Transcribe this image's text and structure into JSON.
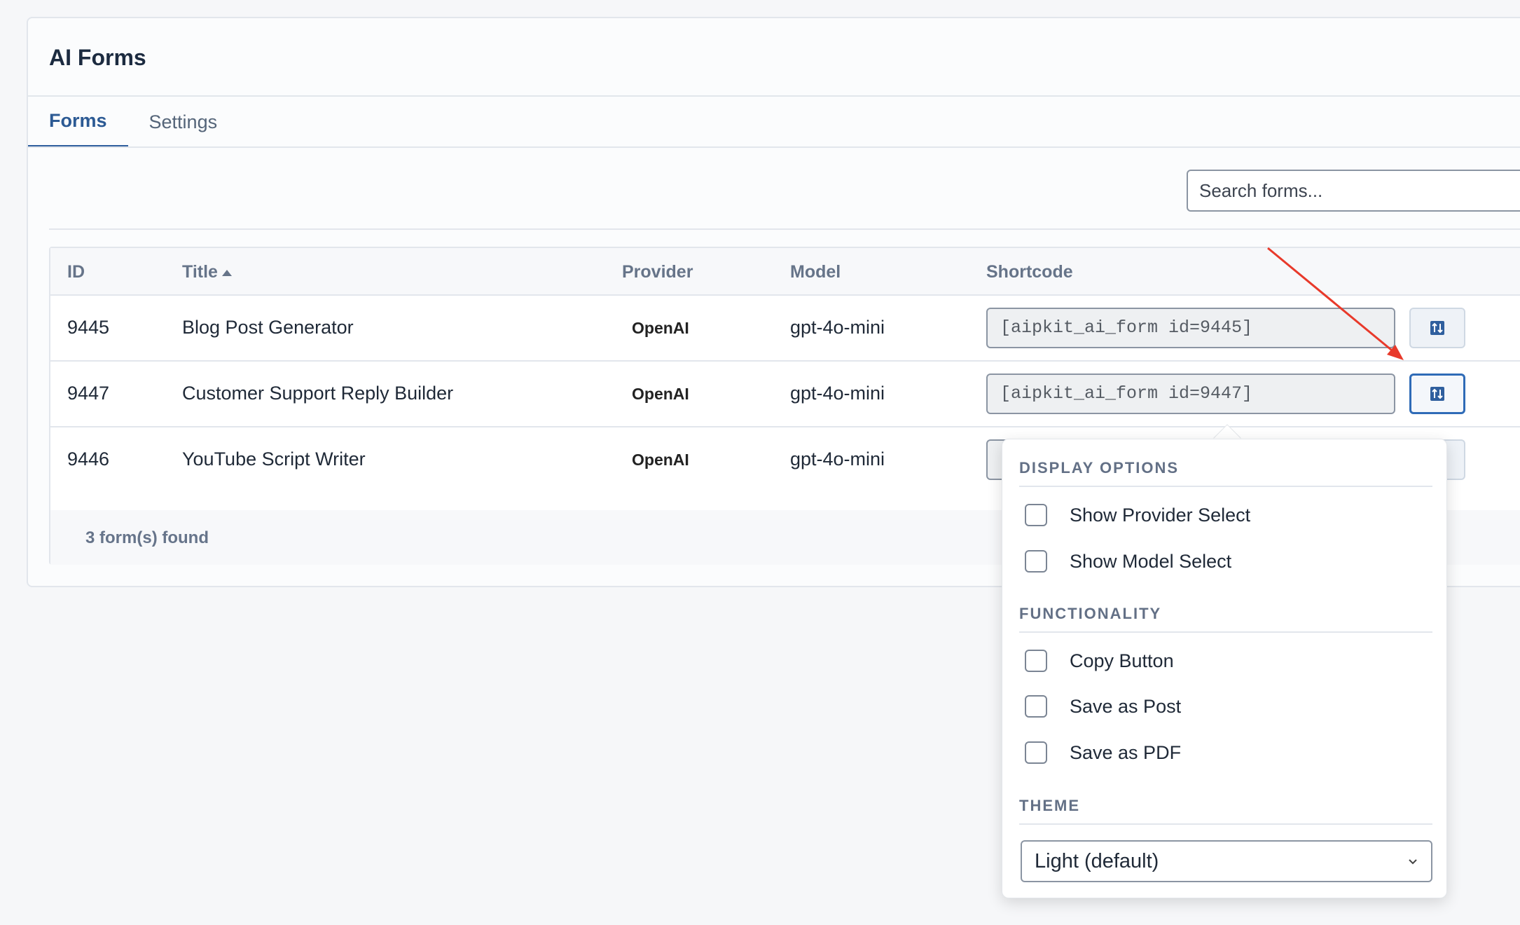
{
  "page": {
    "title": "AI Forms"
  },
  "tabs": [
    {
      "label": "Forms",
      "active": true
    },
    {
      "label": "Settings",
      "active": false
    }
  ],
  "search": {
    "placeholder": "Search forms...",
    "value": ""
  },
  "table": {
    "columns": [
      "ID",
      "Title",
      "Provider",
      "Model",
      "Shortcode"
    ],
    "sort": {
      "column": "Title",
      "direction": "ascending"
    },
    "rows": [
      {
        "id": "9445",
        "title": "Blog Post Generator",
        "provider": "OpenAI",
        "model": "gpt-4o-mini",
        "shortcode": "[aipkit_ai_form id=9445]"
      },
      {
        "id": "9447",
        "title": "Customer Support Reply Builder",
        "provider": "OpenAI",
        "model": "gpt-4o-mini",
        "shortcode": "[aipkit_ai_form id=9447]"
      },
      {
        "id": "9446",
        "title": "YouTube Script Writer",
        "provider": "OpenAI",
        "model": "gpt-4o-mini",
        "shortcode": ""
      }
    ],
    "footer": "3 form(s) found"
  },
  "popover": {
    "sections": {
      "display": {
        "title": "DISPLAY OPTIONS",
        "options": [
          "Show Provider Select",
          "Show Model Select"
        ]
      },
      "functionality": {
        "title": "FUNCTIONALITY",
        "options": [
          "Copy Button",
          "Save as Post",
          "Save as PDF"
        ]
      },
      "theme": {
        "title": "THEME",
        "value": "Light (default)"
      }
    }
  },
  "icons": {
    "options_button": "sort-options-icon",
    "theme_dropdown": "chevron-down-icon",
    "sort_indicator": "sort-ascending-icon"
  },
  "colors": {
    "accent": "#2f5f9e",
    "annotation_arrow": "#e8392a",
    "background": "#f6f7f9"
  }
}
